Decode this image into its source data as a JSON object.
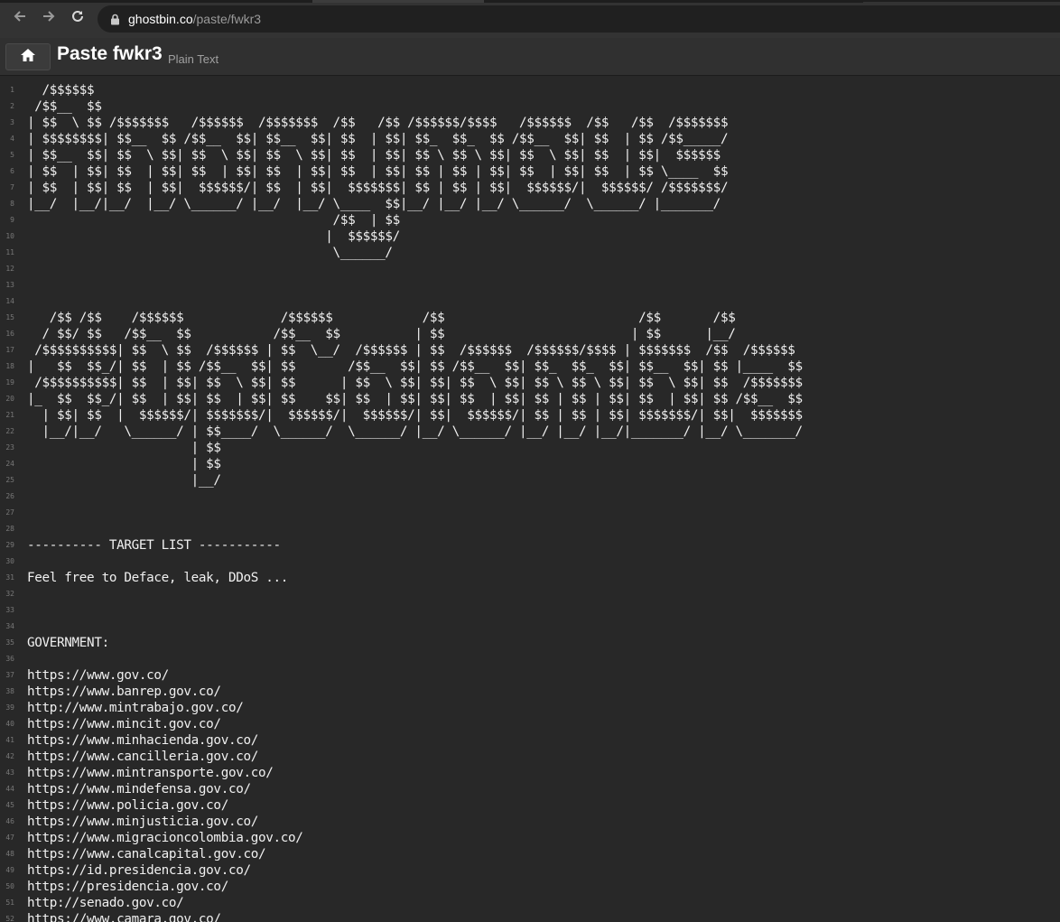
{
  "browser": {
    "url_host": "ghostbin.co",
    "url_path": "/paste/fwkr3",
    "icons": [
      "back-arrow-icon",
      "forward-arrow-icon",
      "reload-icon",
      "lock-icon"
    ]
  },
  "header": {
    "title": "Paste fwkr3",
    "language": "Plain Text",
    "home_icon": "home-icon"
  },
  "colors": {
    "background": "#282828",
    "header": "#303030",
    "line_number": "#777777",
    "text": "#f0f0f0"
  },
  "lines": [
    "  /$$$$$$",
    " /$$__  $$",
    "| $$  \\ $$ /$$$$$$$   /$$$$$$  /$$$$$$$  /$$   /$$ /$$$$$$/$$$$   /$$$$$$  /$$   /$$  /$$$$$$$",
    "| $$$$$$$$| $$__  $$ /$$__  $$| $$__  $$| $$  | $$| $$_  $$_  $$ /$$__  $$| $$  | $$ /$$_____/",
    "| $$__  $$| $$  \\ $$| $$  \\ $$| $$  \\ $$| $$  | $$| $$ \\ $$ \\ $$| $$  \\ $$| $$  | $$|  $$$$$$",
    "| $$  | $$| $$  | $$| $$  | $$| $$  | $$| $$  | $$| $$ | $$ | $$| $$  | $$| $$  | $$ \\____  $$",
    "| $$  | $$| $$  | $$|  $$$$$$/| $$  | $$|  $$$$$$$| $$ | $$ | $$|  $$$$$$/|  $$$$$$/ /$$$$$$$/",
    "|__/  |__/|__/  |__/ \\______/ |__/  |__/ \\____  $$|__/ |__/ |__/ \\______/  \\______/ |_______/",
    "                                         /$$  | $$",
    "                                        |  $$$$$$/",
    "                                         \\______/",
    "",
    "",
    "",
    "   /$$ /$$    /$$$$$$             /$$$$$$            /$$                          /$$       /$$",
    "  / $$/ $$   /$$__  $$           /$$__  $$          | $$                         | $$      |__/",
    " /$$$$$$$$$$| $$  \\ $$  /$$$$$$ | $$  \\__/  /$$$$$$ | $$  /$$$$$$  /$$$$$$/$$$$ | $$$$$$$  /$$  /$$$$$$",
    "|   $$  $$_/| $$  | $$ /$$__  $$| $$       /$$__  $$| $$ /$$__  $$| $$_  $$_  $$| $$__  $$| $$ |____  $$",
    " /$$$$$$$$$$| $$  | $$| $$  \\ $$| $$      | $$  \\ $$| $$| $$  \\ $$| $$ \\ $$ \\ $$| $$  \\ $$| $$  /$$$$$$$",
    "|_  $$  $$_/| $$  | $$| $$  | $$| $$    $$| $$  | $$| $$| $$  | $$| $$ | $$ | $$| $$  | $$| $$ /$$__  $$",
    "  | $$| $$  |  $$$$$$/| $$$$$$$/|  $$$$$$/|  $$$$$$/| $$|  $$$$$$/| $$ | $$ | $$| $$$$$$$/| $$|  $$$$$$$",
    "  |__/|__/   \\______/ | $$____/  \\______/  \\______/ |__/ \\______/ |__/ |__/ |__/|_______/ |__/ \\_______/",
    "                      | $$",
    "                      | $$",
    "                      |__/",
    "",
    "",
    "",
    "---------- TARGET LIST -----------",
    "",
    "Feel free to Deface, leak, DDoS ...",
    "",
    "",
    "",
    "GOVERNMENT:",
    "",
    "https://www.gov.co/",
    "https://www.banrep.gov.co/",
    "http://www.mintrabajo.gov.co/",
    "https://www.mincit.gov.co/",
    "https://www.minhacienda.gov.co/",
    "https://www.cancilleria.gov.co/",
    "https://www.mintransporte.gov.co/",
    "https://www.mindefensa.gov.co/",
    "https://www.policia.gov.co/",
    "https://www.minjusticia.gov.co/",
    "https://www.migracioncolombia.gov.co/",
    "https://www.canalcapital.gov.co/",
    "https://id.presidencia.gov.co/",
    "https://presidencia.gov.co/",
    "http://senado.gov.co/",
    "https://www.camara.gov.co/"
  ]
}
